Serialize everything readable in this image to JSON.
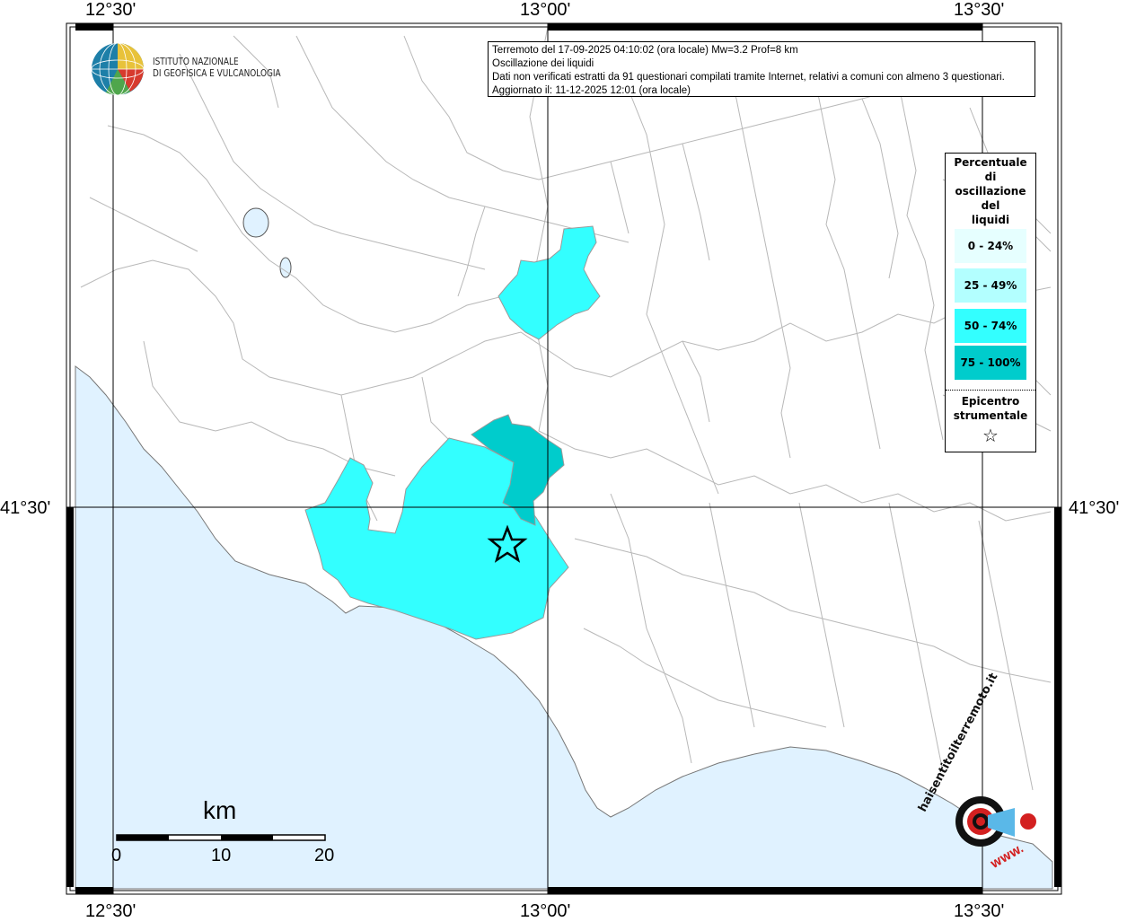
{
  "map": {
    "info": {
      "line1": "Terremoto del 17-09-2025 04:10:02 (ora locale) Mw=3.2 Prof=8 km",
      "line2": "Oscillazione dei liquidi",
      "line3": "Dati non verificati estratti da 91 questionari compilati tramite Internet, relativi a comuni con almeno 3 questionari.",
      "line4": "Aggiornato il: 11-12-2025 12:01 (ora locale)"
    },
    "coords": {
      "top": [
        "12°30'",
        "13°00'",
        "13°30'"
      ],
      "bottom": [
        "12°30'",
        "13°00'",
        "13°30'"
      ],
      "left": "41°30'",
      "right": "41°30'"
    },
    "logo": {
      "line1": "ISTITUTO NAZIONALE",
      "line2": "DI GEOFISICA E VULCANOLOGIA"
    },
    "legend": {
      "title_lines": [
        "Percentuale",
        "di",
        "oscillazione",
        "del",
        "liquidi"
      ],
      "classes": [
        {
          "label": "0 - 24%",
          "color": "#e6ffff"
        },
        {
          "label": "25 - 49%",
          "color": "#b3ffff"
        },
        {
          "label": "50 - 74%",
          "color": "#33ffff"
        },
        {
          "label": "75 - 100%",
          "color": "#00cccc"
        }
      ],
      "epicenter_lines": [
        "Epicentro",
        "strumentale"
      ],
      "epicenter_symbol": "☆"
    },
    "scale": {
      "unit": "km",
      "ticks": [
        "0",
        "10",
        "20"
      ]
    },
    "watermark": {
      "text": "haisentitoilterremoto.it",
      "url_text": "WWW."
    },
    "colors": {
      "sea": "#e0f2ff",
      "land": "#ffffff",
      "border": "#b8b8b8",
      "grid": "#000000"
    },
    "epicenter": {
      "lon": 12.94,
      "lat": 41.47
    }
  }
}
